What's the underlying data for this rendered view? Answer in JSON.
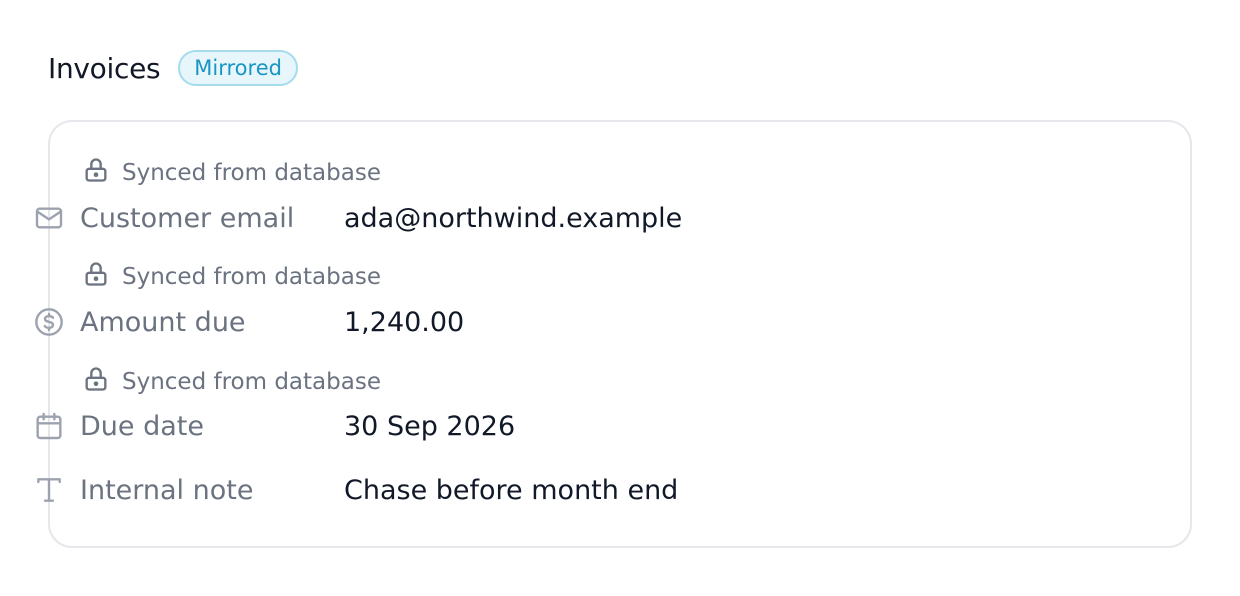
{
  "header": {
    "title": "Invoices",
    "badge": "Mirrored"
  },
  "colors": {
    "badge_bg": "#e6f6fb",
    "badge_border": "#a5dced",
    "badge_text": "#1b95c3",
    "muted_text": "#6b7280",
    "value_text": "#111827"
  },
  "fields": [
    {
      "sync_note": "Synced from database",
      "sync_icon": "lock-icon",
      "icon": "mail-icon",
      "label": "Customer email",
      "value": "ada@northwind.example"
    },
    {
      "sync_note": "Synced from database",
      "sync_icon": "lock-icon",
      "icon": "dollar-circle-icon",
      "label": "Amount due",
      "value": "1,240.00"
    },
    {
      "sync_note": "Synced from database",
      "sync_icon": "lock-icon",
      "icon": "calendar-icon",
      "label": "Due date",
      "value": "30 Sep 2026"
    },
    {
      "icon": "text-type-icon",
      "label": "Internal note",
      "value": "Chase before month end"
    }
  ]
}
